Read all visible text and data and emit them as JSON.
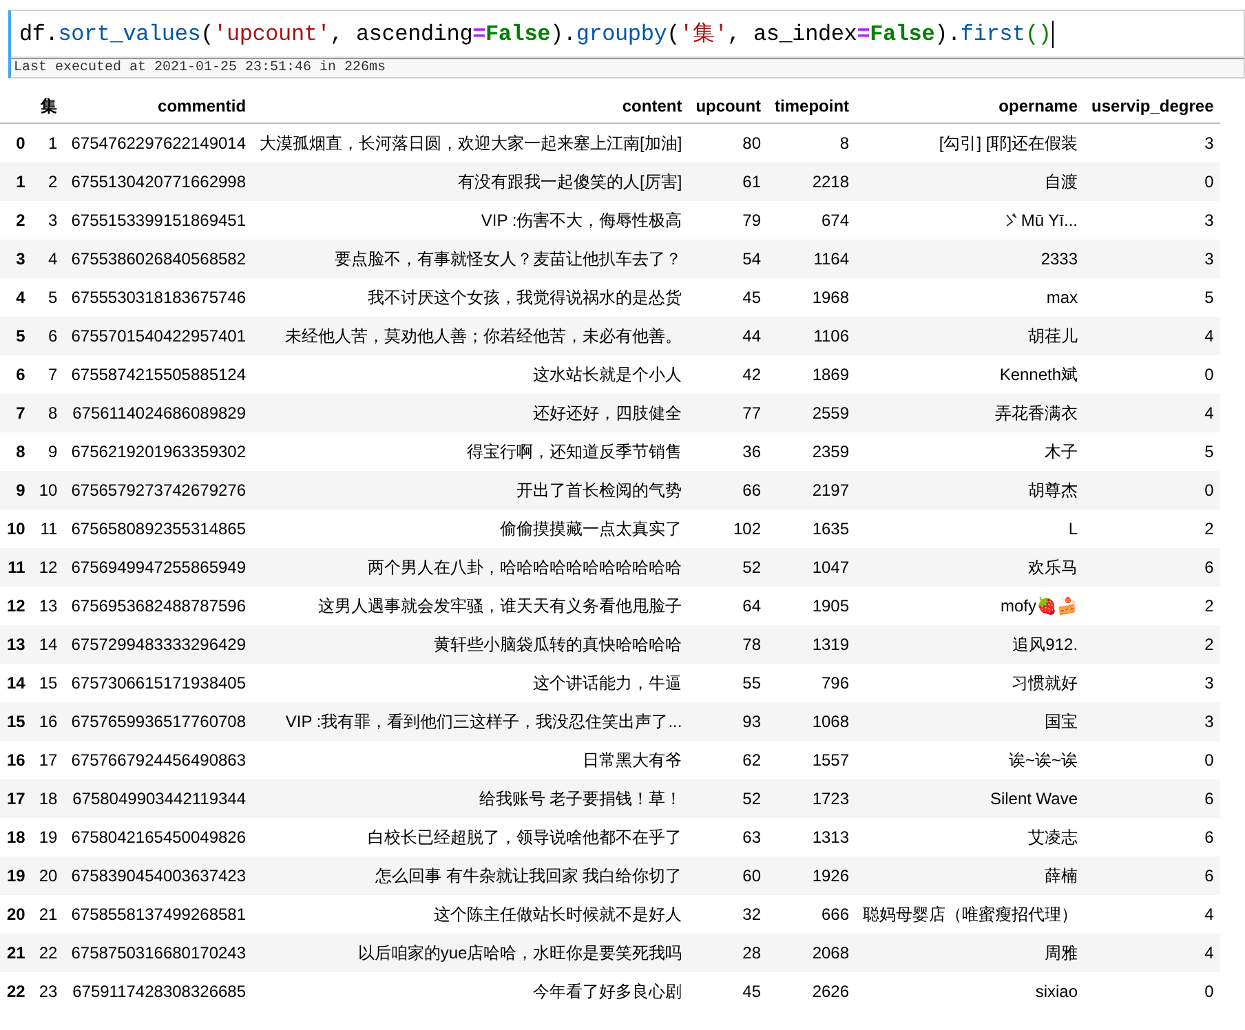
{
  "code_cell": {
    "tokens": [
      {
        "kind": "plain",
        "text": "df."
      },
      {
        "kind": "func",
        "text": "sort_values"
      },
      {
        "kind": "plain",
        "text": "("
      },
      {
        "kind": "string",
        "text": "'upcount'"
      },
      {
        "kind": "plain",
        "text": ", ascending"
      },
      {
        "kind": "op",
        "text": "="
      },
      {
        "kind": "keyword",
        "text": "False"
      },
      {
        "kind": "plain",
        "text": ")."
      },
      {
        "kind": "func",
        "text": "groupby"
      },
      {
        "kind": "plain",
        "text": "("
      },
      {
        "kind": "string",
        "text": "'集'"
      },
      {
        "kind": "plain",
        "text": ", as_index"
      },
      {
        "kind": "op",
        "text": "="
      },
      {
        "kind": "keyword",
        "text": "False"
      },
      {
        "kind": "plain",
        "text": ")."
      },
      {
        "kind": "func",
        "text": "first"
      },
      {
        "kind": "paren",
        "text": "()"
      }
    ],
    "execution_note": "Last executed at 2021-01-25 23:51:46 in 226ms"
  },
  "table": {
    "columns": [
      "集",
      "commentid",
      "content",
      "upcount",
      "timepoint",
      "opername",
      "uservip_degree"
    ],
    "rows": [
      {
        "index": "0",
        "cells": [
          "1",
          "6754762297622149014",
          "大漠孤烟直，长河落日圆，欢迎大家一起来塞上江南[加油]",
          "80",
          "8",
          "[勾引] [耶]还在假装",
          "3"
        ]
      },
      {
        "index": "1",
        "cells": [
          "2",
          "6755130420771662998",
          "有没有跟我一起傻笑的人[厉害]",
          "61",
          "2218",
          "自渡",
          "0"
        ]
      },
      {
        "index": "2",
        "opername_mark": true,
        "cells": [
          "3",
          "6755153399151869451",
          "VIP :伤害不大，侮辱性极高",
          "79",
          "674",
          "Mū Yī...",
          "3"
        ]
      },
      {
        "index": "3",
        "cells": [
          "4",
          "6755386026840568582",
          "要点脸不，有事就怪女人？麦苗让他扒车去了？",
          "54",
          "1164",
          "2333",
          "3"
        ]
      },
      {
        "index": "4",
        "cells": [
          "5",
          "6755530318183675746",
          "我不讨厌这个女孩，我觉得说祸水的是怂货",
          "45",
          "1968",
          "max",
          "5"
        ]
      },
      {
        "index": "5",
        "cells": [
          "6",
          "6755701540422957401",
          "未经他人苦，莫劝他人善；你若经他苦，未必有他善。",
          "44",
          "1106",
          "胡荏儿",
          "4"
        ]
      },
      {
        "index": "6",
        "cells": [
          "7",
          "6755874215505885124",
          "这水站长就是个小人",
          "42",
          "1869",
          "Kenneth斌",
          "0"
        ]
      },
      {
        "index": "7",
        "cells": [
          "8",
          "6756114024686089829",
          "还好还好，四肢健全",
          "77",
          "2559",
          "弄花香满衣",
          "4"
        ]
      },
      {
        "index": "8",
        "cells": [
          "9",
          "6756219201963359302",
          "得宝行啊，还知道反季节销售",
          "36",
          "2359",
          "木子",
          "5"
        ]
      },
      {
        "index": "9",
        "cells": [
          "10",
          "6756579273742679276",
          "开出了首长检阅的气势",
          "66",
          "2197",
          "胡尊杰",
          "0"
        ]
      },
      {
        "index": "10",
        "cells": [
          "11",
          "6756580892355314865",
          "偷偷摸摸藏一点太真实了",
          "102",
          "1635",
          "L",
          "2"
        ]
      },
      {
        "index": "11",
        "cells": [
          "12",
          "6756949947255865949",
          "两个男人在八卦，哈哈哈哈哈哈哈哈哈哈哈",
          "52",
          "1047",
          "欢乐马",
          "6"
        ]
      },
      {
        "index": "12",
        "cells": [
          "13",
          "6756953682488787596",
          "这男人遇事就会发牢骚，谁天天有义务看他甩脸子",
          "64",
          "1905",
          "mofy🍓🍰",
          "2"
        ]
      },
      {
        "index": "13",
        "cells": [
          "14",
          "6757299483333296429",
          "黄轩些小脑袋瓜转的真快哈哈哈哈",
          "78",
          "1319",
          "追风912.",
          "2"
        ]
      },
      {
        "index": "14",
        "cells": [
          "15",
          "6757306615171938405",
          "这个讲话能力，牛逼",
          "55",
          "796",
          "习惯就好",
          "3"
        ]
      },
      {
        "index": "15",
        "cells": [
          "16",
          "6757659936517760708",
          "VIP :我有罪，看到他们三这样子，我没忍住笑出声了...",
          "93",
          "1068",
          "国宝",
          "3"
        ]
      },
      {
        "index": "16",
        "cells": [
          "17",
          "6757667924456490863",
          "日常黑大有爷",
          "62",
          "1557",
          "诶~诶~诶",
          "0"
        ]
      },
      {
        "index": "17",
        "cells": [
          "18",
          "6758049903442119344",
          "给我账号 老子要捐钱！草！",
          "52",
          "1723",
          "Silent Wave",
          "6"
        ]
      },
      {
        "index": "18",
        "cells": [
          "19",
          "6758042165450049826",
          "白校长已经超脱了，领导说啥他都不在乎了",
          "63",
          "1313",
          "艾凌志",
          "6"
        ]
      },
      {
        "index": "19",
        "cells": [
          "20",
          "6758390454003637423",
          "怎么回事 有牛杂就让我回家 我白给你切了",
          "60",
          "1926",
          "薛楠",
          "6"
        ]
      },
      {
        "index": "20",
        "cells": [
          "21",
          "6758558137499268581",
          "这个陈主任做站长时候就不是好人",
          "32",
          "666",
          "聪妈母婴店（唯蜜瘦招代理）",
          "4"
        ]
      },
      {
        "index": "21",
        "cells": [
          "22",
          "6758750316680170243",
          "以后咱家的yue店哈哈，水旺你是要笑死我吗",
          "28",
          "2068",
          "周雅",
          "4"
        ]
      },
      {
        "index": "22",
        "cells": [
          "23",
          "6759117428308326685",
          "今年看了好多良心剧",
          "45",
          "2626",
          "sixiao",
          "0"
        ]
      }
    ]
  }
}
